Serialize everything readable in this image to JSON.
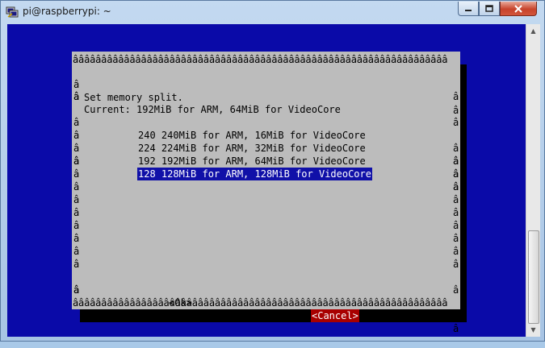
{
  "window": {
    "title": "pi@raspberrypi: ~",
    "min_glyph": "–",
    "max_glyph": "☐",
    "close_glyph": "✕"
  },
  "dialog": {
    "border_top": "ââââââââââââââââââââââââââââââââââââââââââââââââââââââââââââââââââ",
    "border_bottom": "ââââââââââââââââââââââââââââââââââââââââââââââââââââââââââââââââââ",
    "side_char": "â",
    "line1": "Set memory split.",
    "line2": "Current: 192MiB for ARM, 64MiB for VideoCore",
    "options": [
      {
        "label": "240 240MiB for ARM, 16MiB for VideoCore"
      },
      {
        "label": "224 224MiB for ARM, 32MiB for VideoCore"
      },
      {
        "label": "192 192MiB for ARM, 64MiB for VideoCore"
      },
      {
        "label": "128 128MiB for ARM, 128MiB for VideoCore"
      }
    ],
    "selected_option": "128 128MiB for ARM, 128MiB for VideoCore",
    "ok_label": "<Ok>",
    "cancel_label": "<Cancel>"
  },
  "colors": {
    "terminal_bg": "#0a0aa8",
    "dialog_bg": "#bcbcbc",
    "selection_bg": "#1010a8",
    "cancel_bg": "#a80000"
  },
  "icons": {
    "app": "putty-icon",
    "scroll_up": "arrow-up-icon",
    "scroll_down": "arrow-down-icon"
  }
}
